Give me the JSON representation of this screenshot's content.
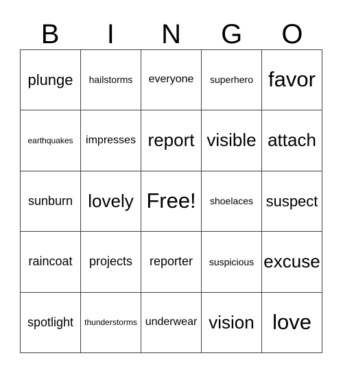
{
  "card": {
    "header_letters": [
      "B",
      "I",
      "N",
      "G",
      "O"
    ],
    "rows": [
      [
        {
          "text": "plunge",
          "size": "xl"
        },
        {
          "text": "hailstorms",
          "size": "s"
        },
        {
          "text": "everyone",
          "size": "m"
        },
        {
          "text": "superhero",
          "size": "s"
        },
        {
          "text": "favor",
          "size": "huge"
        }
      ],
      [
        {
          "text": "earthquakes",
          "size": "xs"
        },
        {
          "text": "impresses",
          "size": "m"
        },
        {
          "text": "report",
          "size": "xxl"
        },
        {
          "text": "visible",
          "size": "xxl"
        },
        {
          "text": "attach",
          "size": "xxl"
        }
      ],
      [
        {
          "text": "sunburn",
          "size": "l"
        },
        {
          "text": "lovely",
          "size": "xxl"
        },
        {
          "text": "Free!",
          "size": "huge"
        },
        {
          "text": "shoelaces",
          "size": "s"
        },
        {
          "text": "suspect",
          "size": "xl"
        }
      ],
      [
        {
          "text": "raincoat",
          "size": "l"
        },
        {
          "text": "projects",
          "size": "l"
        },
        {
          "text": "reporter",
          "size": "l"
        },
        {
          "text": "suspicious",
          "size": "s"
        },
        {
          "text": "excuse",
          "size": "xxl"
        }
      ],
      [
        {
          "text": "spotlight",
          "size": "l"
        },
        {
          "text": "thunderstorms",
          "size": "xs"
        },
        {
          "text": "underwear",
          "size": "m"
        },
        {
          "text": "vision",
          "size": "xxl"
        },
        {
          "text": "love",
          "size": "huge"
        }
      ]
    ],
    "colors": {
      "text": "#000000",
      "grid_line": "#404040",
      "background": "#ffffff"
    }
  }
}
